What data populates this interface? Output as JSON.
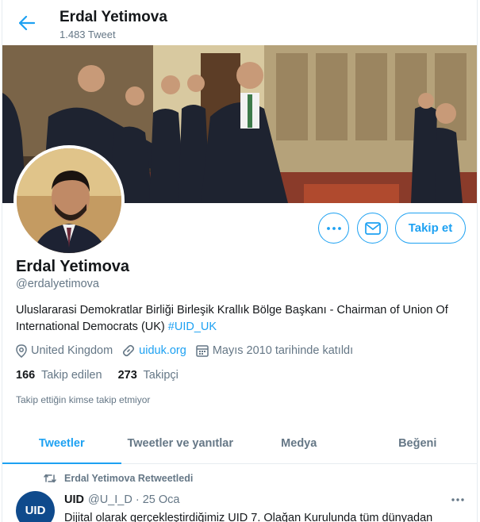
{
  "header": {
    "name": "Erdal Yetimova",
    "tweet_count": "1.483 Tweet"
  },
  "actions": {
    "follow_label": "Takip et"
  },
  "profile": {
    "name": "Erdal Yetimova",
    "handle": "@erdalyetimova",
    "bio_text": "Uluslararasi Demokratlar Birliği Birleşik Krallık Bölge Başkanı - Chairman of Union Of International Democrats (UK)",
    "bio_hashtag": "#UID_UK",
    "location": "United Kingdom",
    "website": "uiduk.org",
    "joined": "Mayıs 2010 tarihinde katıldı",
    "following_count": "166",
    "following_label": "Takip edilen",
    "followers_count": "273",
    "followers_label": "Takipçi",
    "known_followers": "Takip ettiğin kimse takip etmiyor"
  },
  "tabs": [
    {
      "label": "Tweetler",
      "active": true
    },
    {
      "label": "Tweetler ve yanıtlar",
      "active": false
    },
    {
      "label": "Medya",
      "active": false
    },
    {
      "label": "Beğeni",
      "active": false
    }
  ],
  "tweet": {
    "retweet_note": "Erdal Yetimova Retweetledi",
    "avatar_text": "UID",
    "author": "UID",
    "meta": "@U_I_D · 25 Oca",
    "text": "Dijital olarak gerçekleştirdiğimiz UID 7. Olağan Kurulunda tüm dünyadan"
  },
  "colors": {
    "accent": "#1da1f2",
    "secondary_text": "#657786",
    "primary_text": "#14171a"
  },
  "icons": [
    "back-arrow-icon",
    "more-icon",
    "mail-icon",
    "location-icon",
    "link-icon",
    "calendar-icon",
    "retweet-icon"
  ]
}
